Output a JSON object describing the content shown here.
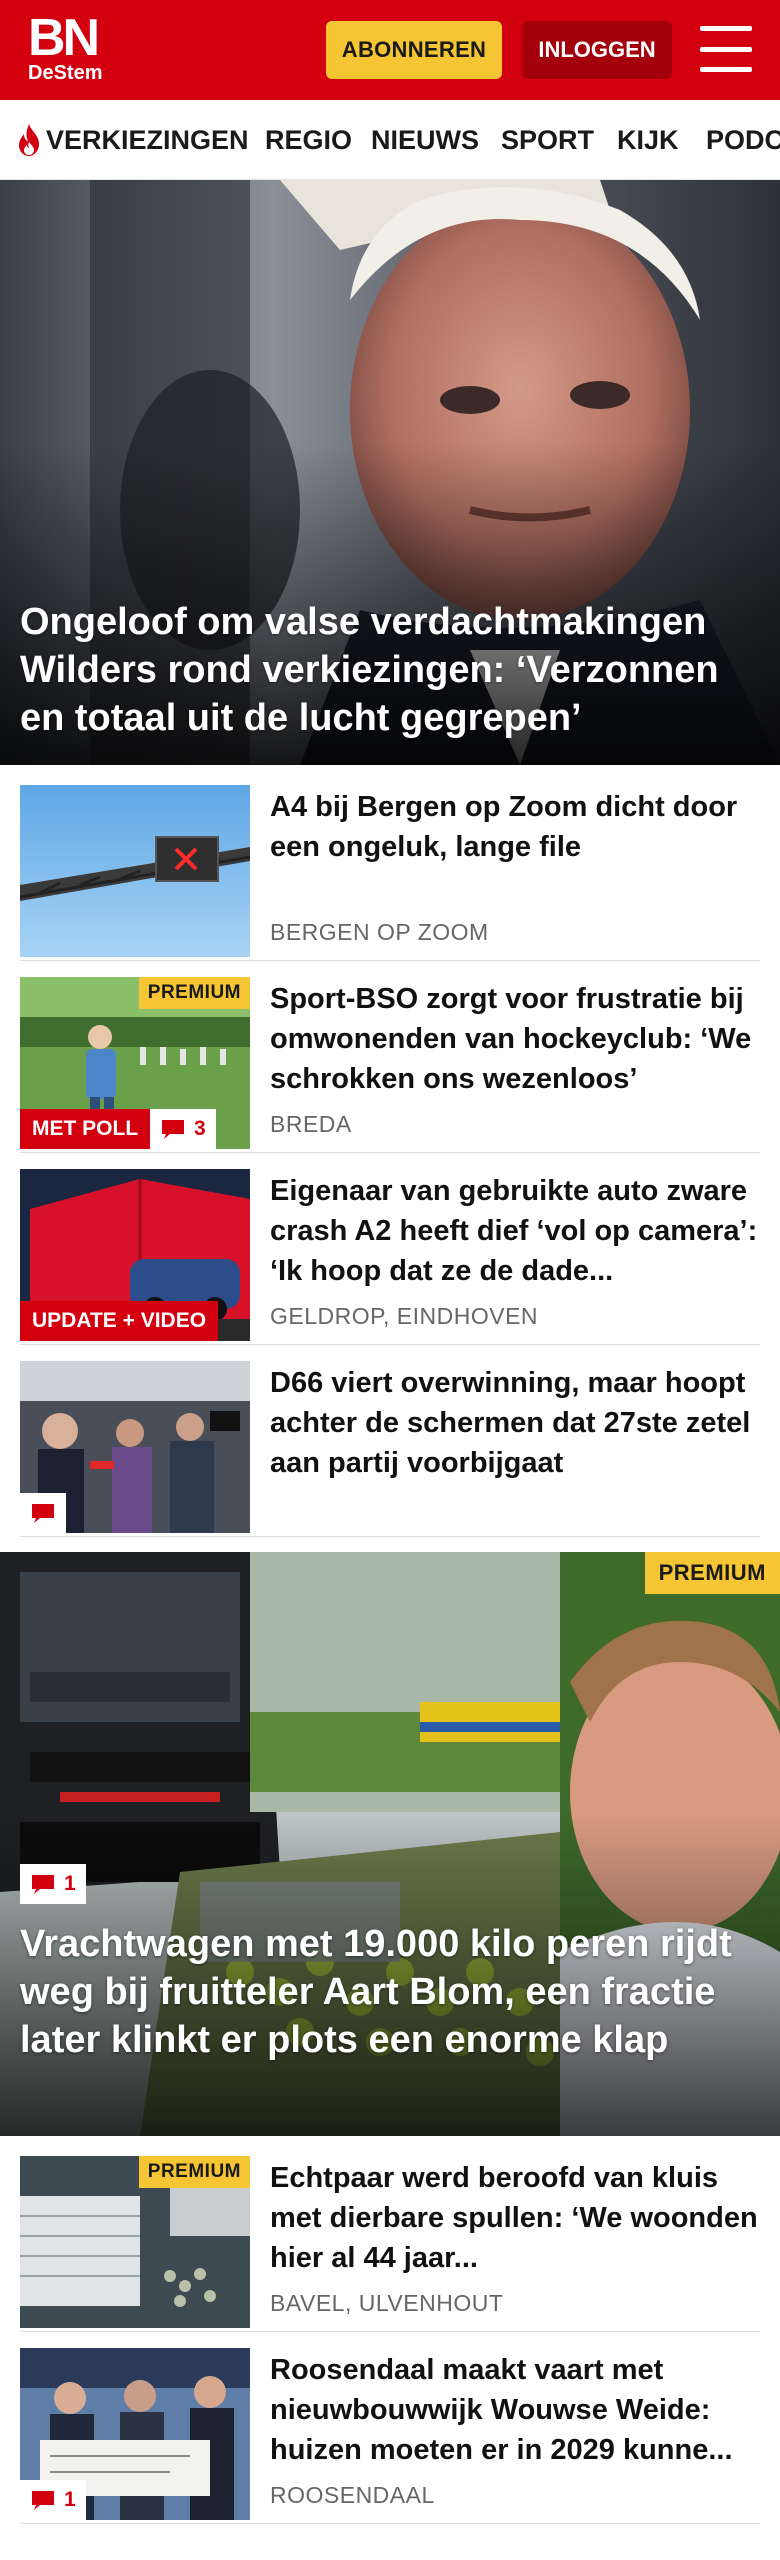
{
  "header": {
    "logo_main": "BN",
    "logo_sub": "DeStem",
    "subscribe_label": "ABONNEREN",
    "login_label": "INLOGGEN",
    "brand_color": "#d3000f",
    "accent_color": "#f5c533"
  },
  "nav": {
    "items": [
      {
        "label": "VERKIEZINGEN",
        "icon": "flame-icon"
      },
      {
        "label": "REGIO"
      },
      {
        "label": "NIEUWS"
      },
      {
        "label": "SPORT"
      },
      {
        "label": "KIJK"
      },
      {
        "label": "PODC"
      }
    ]
  },
  "hero": {
    "title": "Ongeloof om valse verdachtmakingen Wilders rond verkiezingen: ‘Verzonnen en totaal uit de lucht gegrepen’"
  },
  "articles": [
    {
      "title": "A4 bij Bergen op Zoom dicht door een ongeluk, lange file",
      "location": "BERGEN OP ZOOM"
    },
    {
      "title": "Sport-BSO zorgt voor frustratie bij omwonenden van hockeyclub: ‘We schrokken ons wezenloos’",
      "location": "BREDA",
      "premium": "PREMIUM",
      "label": "MET POLL",
      "comments": "3"
    },
    {
      "title": "Eigenaar van gebruikte auto zware crash A2 heeft dief ‘vol op camera’: ‘Ik hoop dat ze de dade...",
      "location": "GELDROP, EINDHOVEN",
      "label": "UPDATE + VIDEO"
    },
    {
      "title": "D66 viert overwinning, maar hoopt achter de schermen dat 27ste zetel aan partij voorbijgaat"
    }
  ],
  "feature": {
    "title": "Vrachtwagen met 19.000 kilo peren rijdt weg bij fruitteler Aart Blom, een fractie later klinkt er plots een enorme klap",
    "premium": "PREMIUM",
    "comments": "1"
  },
  "articles2": [
    {
      "title": "Echtpaar werd beroofd van kluis met dierbare spullen: ‘We woonden hier al 44 jaar...",
      "location": "BAVEL, ULVENHOUT",
      "premium": "PREMIUM"
    },
    {
      "title": "Roosendaal maakt vaart met nieuwbouwwijk Wouwse Weide: huizen moeten er in 2029 kunne...",
      "location": "ROOSENDAAL",
      "comments": "1"
    }
  ]
}
